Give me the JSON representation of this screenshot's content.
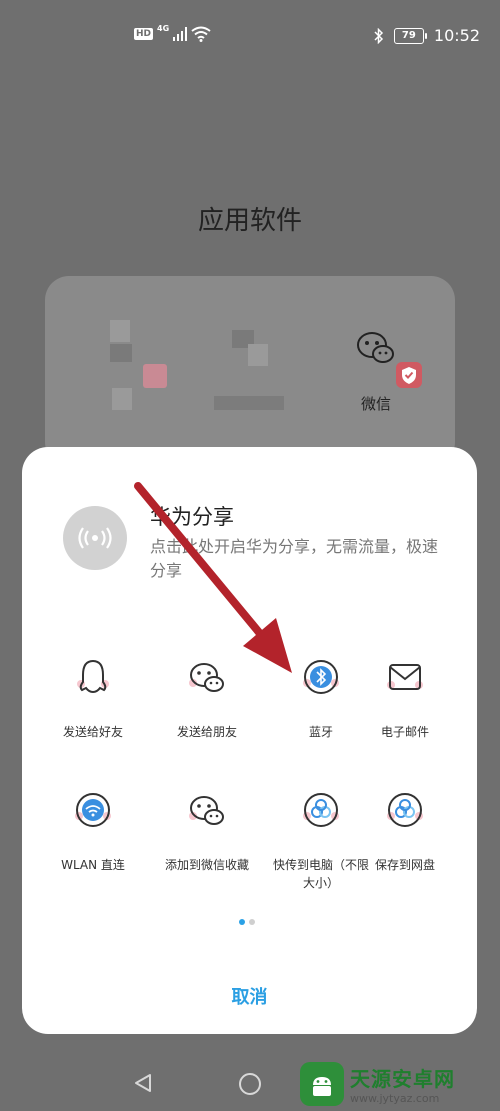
{
  "status_bar": {
    "hd": "HD",
    "network": "4G",
    "battery": "79",
    "time": "10:52"
  },
  "background": {
    "title": "应用软件",
    "wechat_label": "微信"
  },
  "share_sheet": {
    "huawei_share": {
      "title": "华为分享",
      "description": "点击此处开启华为分享，无需流量，极速分享"
    },
    "rows": [
      [
        {
          "label": "发送给好友",
          "icon": "qq-icon"
        },
        {
          "label": "发送给朋友",
          "icon": "wechat-icon"
        },
        {
          "label": "蓝牙",
          "icon": "bluetooth-icon"
        },
        {
          "label": "电子邮件",
          "icon": "email-icon"
        }
      ],
      [
        {
          "label": "WLAN 直连",
          "icon": "wlan-direct-icon"
        },
        {
          "label": "添加到微信收藏",
          "icon": "wechat-favorite-icon"
        },
        {
          "label": "快传到电脑（不限大小）",
          "icon": "transfer-to-pc-icon"
        },
        {
          "label": "保存到网盘",
          "icon": "cloud-drive-icon"
        }
      ]
    ],
    "pager": {
      "current": 1,
      "total": 2
    },
    "cancel": "取消"
  },
  "watermark": {
    "name": "天源安卓网",
    "url": "www.jytyaz.com"
  },
  "colors": {
    "accent": "#2b9fe3",
    "overlay_background": "#6f6f6f",
    "arrow": "#b3232b"
  }
}
